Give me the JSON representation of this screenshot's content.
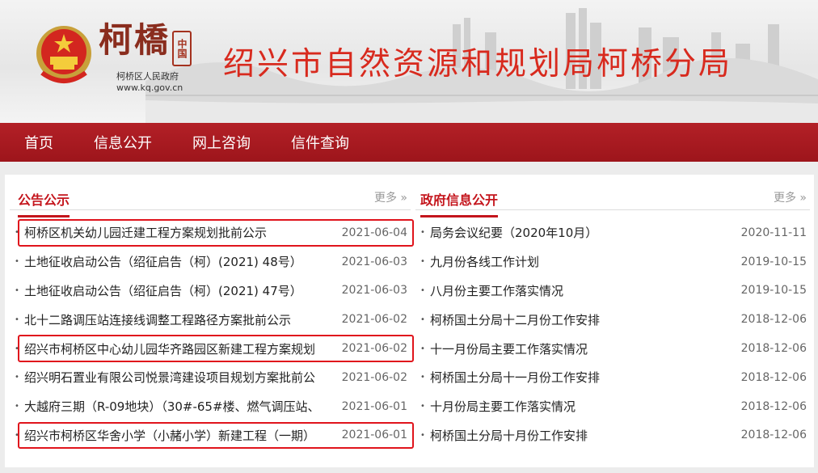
{
  "header": {
    "logo_word": "柯橋",
    "logo_seal": "中国",
    "logo_sub": "柯桥区人民政府",
    "logo_url": "www.kq.gov.cn",
    "site_title": "绍兴市自然资源和规划局柯桥分局"
  },
  "nav": [
    "首页",
    "信息公开",
    "网上咨询",
    "信件查询"
  ],
  "left": {
    "title": "公告公示",
    "more": "更多 »",
    "items": [
      {
        "text": "柯桥区机关幼儿园迁建工程方案规划批前公示",
        "date": "2021-06-04",
        "highlight": true
      },
      {
        "text": "土地征收启动公告（绍征启告（柯）(2021) 48号）",
        "date": "2021-06-03",
        "highlight": false
      },
      {
        "text": "土地征收启动公告（绍征启告（柯）(2021) 47号）",
        "date": "2021-06-03",
        "highlight": false
      },
      {
        "text": "北十二路调压站连接线调整工程路径方案批前公示",
        "date": "2021-06-02",
        "highlight": false
      },
      {
        "text": "绍兴市柯桥区中心幼儿园华齐路园区新建工程方案规划",
        "date": "2021-06-02",
        "highlight": true
      },
      {
        "text": "绍兴明石置业有限公司悦景湾建设项目规划方案批前公",
        "date": "2021-06-02",
        "highlight": false
      },
      {
        "text": "大越府三期（R-09地块）（30#-65#楼、燃气调压站、",
        "date": "2021-06-01",
        "highlight": false
      },
      {
        "text": "绍兴市柯桥区华舍小学（小赭小学）新建工程（一期）",
        "date": "2021-06-01",
        "highlight": true
      }
    ]
  },
  "right": {
    "title": "政府信息公开",
    "more": "更多 »",
    "items": [
      {
        "text": "局务会议纪要（2020年10月）",
        "date": "2020-11-11"
      },
      {
        "text": "九月份各线工作计划",
        "date": "2019-10-15"
      },
      {
        "text": "八月份主要工作落实情况",
        "date": "2019-10-15"
      },
      {
        "text": "柯桥国土分局十二月份工作安排",
        "date": "2018-12-06"
      },
      {
        "text": "十一月份局主要工作落实情况",
        "date": "2018-12-06"
      },
      {
        "text": "柯桥国土分局十一月份工作安排",
        "date": "2018-12-06"
      },
      {
        "text": "十月份局主要工作落实情况",
        "date": "2018-12-06"
      },
      {
        "text": "柯桥国土分局十月份工作安排",
        "date": "2018-12-06"
      }
    ]
  },
  "colors": {
    "nav_red": "#a8181f",
    "title_red": "#d82a1e",
    "highlight_red": "#e0141c"
  }
}
